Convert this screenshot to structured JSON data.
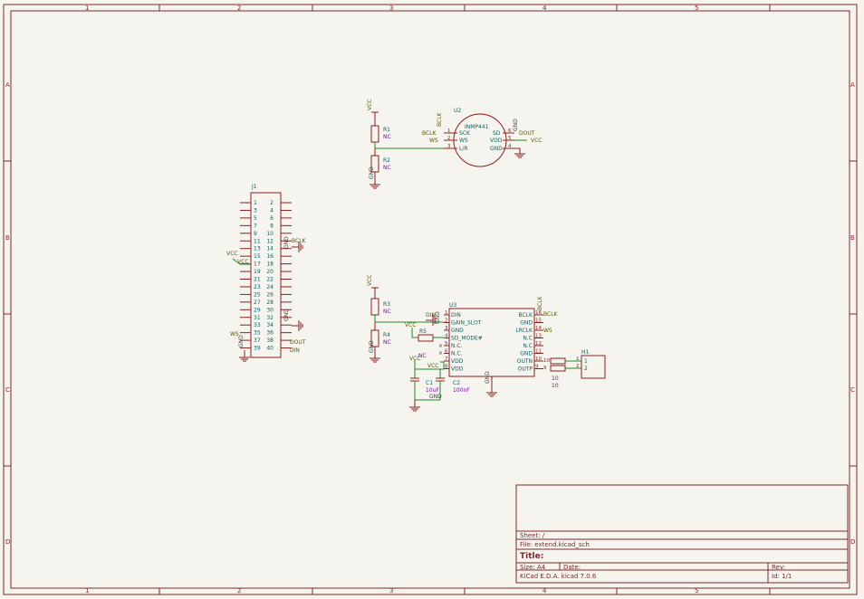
{
  "frame": {
    "columns": [
      "1",
      "2",
      "3",
      "4",
      "5"
    ],
    "rows": [
      "A",
      "B",
      "C",
      "D"
    ]
  },
  "j1": {
    "ref": "J1",
    "odd_pins": [
      "1",
      "3",
      "5",
      "7",
      "9",
      "11",
      "13",
      "15",
      "17",
      "19",
      "21",
      "23",
      "25",
      "27",
      "29",
      "31",
      "33",
      "35",
      "37",
      "39"
    ],
    "even_pins": [
      "2",
      "4",
      "6",
      "8",
      "10",
      "12",
      "14",
      "16",
      "18",
      "20",
      "22",
      "24",
      "26",
      "28",
      "30",
      "32",
      "34",
      "36",
      "38",
      "40"
    ],
    "labels": {
      "vcc": "VCC",
      "bclk": "BCLK",
      "ws": "WS",
      "dout": "DOUT",
      "din": "DIN",
      "gnd_left": "GND",
      "gnd_right_a": "GND",
      "gnd_right_b": "GND"
    }
  },
  "mic": {
    "ref": "U2",
    "name": "INMP441",
    "left_pins": [
      {
        "num": "1",
        "name": "SCK",
        "label": "BCLK"
      },
      {
        "num": "2",
        "name": "WS",
        "label": "WS"
      },
      {
        "num": "3",
        "name": "L/R",
        "label": ""
      }
    ],
    "right_pins": [
      {
        "num": "6",
        "name": "SD",
        "label": "DOUT"
      },
      {
        "num": "5",
        "name": "VDD",
        "label": "VCC"
      },
      {
        "num": "4",
        "name": "GND",
        "label": ""
      }
    ],
    "top_label": "BCLK",
    "gnd_label": "GND"
  },
  "r1": {
    "ref": "R1",
    "value": "NC"
  },
  "r2": {
    "ref": "R2",
    "value": "NC"
  },
  "r3": {
    "ref": "R3",
    "value": "NC"
  },
  "r4": {
    "ref": "R4",
    "value": "NC"
  },
  "r5": {
    "ref": "R5",
    "value": ""
  },
  "vcc": "VCC",
  "gnd": "GND",
  "amp": {
    "ref": "U3",
    "left_pins": [
      {
        "num": "1",
        "name": "DIN"
      },
      {
        "num": "2",
        "name": "GAIN_SLOT"
      },
      {
        "num": "3",
        "name": "GND"
      },
      {
        "num": "4",
        "name": "SD_MODE#"
      },
      {
        "num": "5",
        "name": "N.C."
      },
      {
        "num": "6",
        "name": "N.C."
      },
      {
        "num": "7",
        "name": "VDD"
      },
      {
        "num": "8",
        "name": "VDD"
      }
    ],
    "right_pins": [
      {
        "num": "16",
        "name": "BCLK"
      },
      {
        "num": "15",
        "name": "GND"
      },
      {
        "num": "14",
        "name": "LRCLK"
      },
      {
        "num": "13",
        "name": "N.C"
      },
      {
        "num": "12",
        "name": "N.C"
      },
      {
        "num": "11",
        "name": "GND"
      },
      {
        "num": "10",
        "name": "OUTN"
      },
      {
        "num": "9",
        "name": "OUTP"
      }
    ],
    "labels": {
      "din": "DIN",
      "gnd_top": "GND",
      "vcc_r5": "VCC",
      "vcc_vdd": "VCC",
      "nc": "NC",
      "bclk": "BCLK",
      "ws": "WS",
      "bclk_top": "BCLK",
      "gnd_bottom": "GND"
    }
  },
  "c1": {
    "ref": "C1",
    "value": "10uF"
  },
  "c2": {
    "ref": "C2",
    "value": "100nF"
  },
  "cap_gnd": "GND",
  "out_resistors": {
    "top_value": "10",
    "bottom_value": "10",
    "top_num": "10",
    "bottom_num": "9"
  },
  "speaker": {
    "ref": "H1",
    "pins": [
      "1",
      "2"
    ],
    "pin_labels": [
      "1",
      "2"
    ]
  },
  "title_block": {
    "sheet": "Sheet: /",
    "file": "File: extend.kicad_sch",
    "title_label": "Title:",
    "size": "Size: A4",
    "date": "Date:",
    "rev": "Rev:",
    "tool": "KiCad E.D.A.  kicad 7.0.6",
    "id": "Id: 1/1"
  }
}
